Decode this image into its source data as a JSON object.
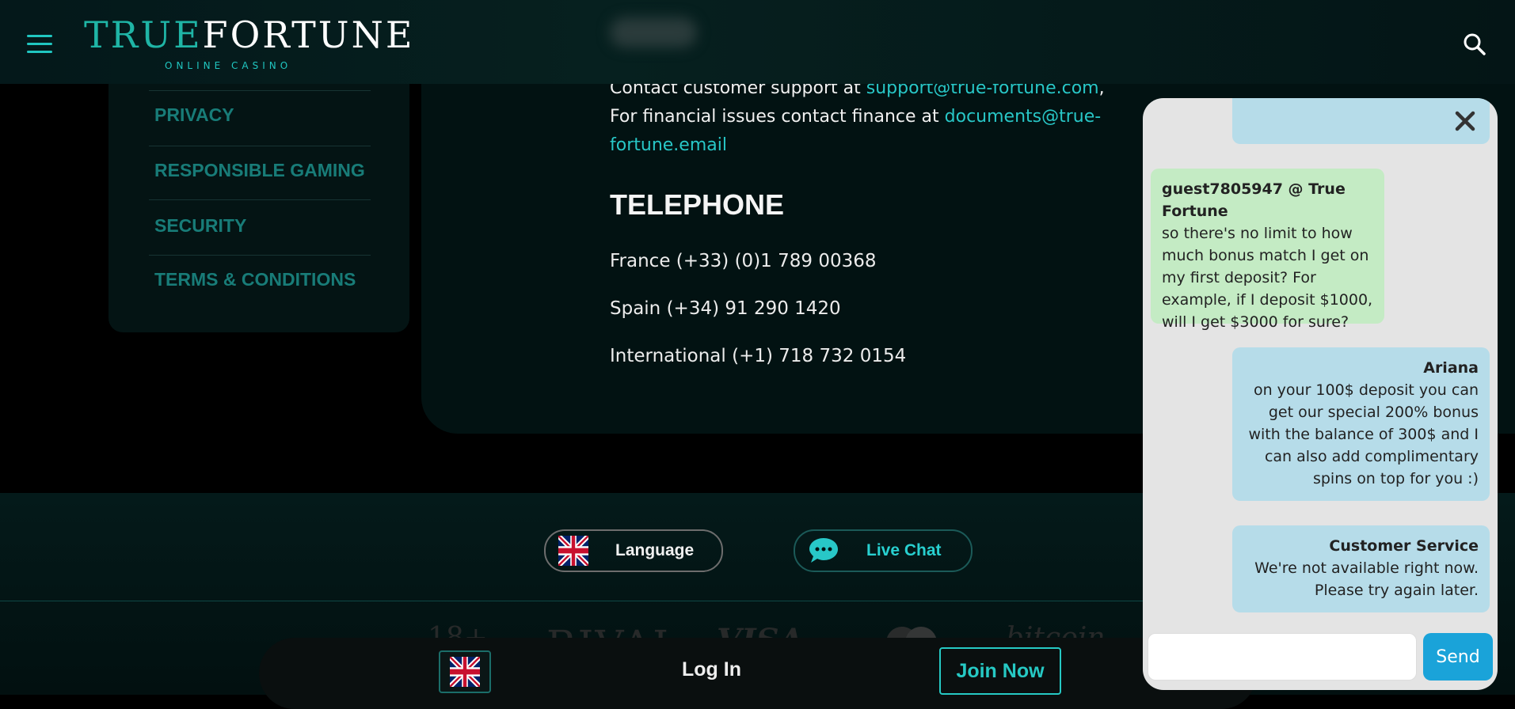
{
  "header": {
    "logo_true": "TRUE",
    "logo_fortune": "FORTUNE",
    "logo_sub": "ONLINE CASINO",
    "menu_icon": "hamburger-icon",
    "search_icon": "search-icon"
  },
  "sidebar": {
    "items": [
      {
        "label": "PRIVACY"
      },
      {
        "label": "RESPONSIBLE GAMING"
      },
      {
        "label": "SECURITY"
      },
      {
        "label": "TERMS & CONDITIONS"
      }
    ]
  },
  "contact": {
    "support_prefix": "Contact customer support at ",
    "support_email": "support@true-fortune.com",
    "support_suffix": ",",
    "finance_prefix": "For financial issues contact finance at ",
    "finance_email_part1": "documents@true-",
    "finance_email_part2": "fortune.email",
    "telephone_heading": "TELEPHONE",
    "phones": [
      "France (+33) (0)1 789 00368",
      "Spain (+34) 91 290 1420",
      "International (+1) 718 732 0154"
    ]
  },
  "footer": {
    "language_label": "Language",
    "live_chat_label": "Live Chat",
    "flag_icon": "uk-flag-icon",
    "chat_icon": "chat-bubble-icon",
    "partner_logos": [
      "18+",
      "RIVAL",
      "VISA",
      "mastercard",
      "bitcoin"
    ]
  },
  "bottom_bar": {
    "login_label": "Log In",
    "join_label": "Join Now"
  },
  "chat": {
    "close_icon": "close-icon",
    "messages": [
      {
        "author": "guest7805947 @ True Fortune",
        "text": "so there's no limit to how much bonus match I get on my first deposit? For example, if I deposit $1000, will I get $3000 for sure?"
      },
      {
        "author": "Ariana",
        "text": "on your 100$ deposit you can get our special 200% bonus with the balance of 300$ and I can also add complimentary spins on top for you :)"
      },
      {
        "author": "Customer Service",
        "text": "We're not available right now. Please try again later."
      }
    ],
    "input_placeholder": "",
    "send_label": "Send"
  },
  "colors": {
    "accent": "#20c6c0",
    "nav_text": "#187c78",
    "guest_bubble": "#c4ebc4",
    "agent_bubble": "#b6dce9",
    "send_button": "#1aa3d9"
  }
}
